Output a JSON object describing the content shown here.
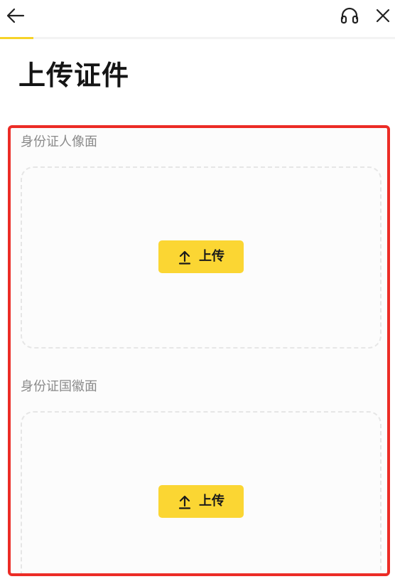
{
  "header": {
    "back_icon": "arrow-left-icon",
    "support_icon": "headset-icon",
    "close_icon": "close-icon",
    "progress_fraction": 0.085,
    "progress_color": "#f6d328"
  },
  "page": {
    "title": "上传证件"
  },
  "upload_sections": [
    {
      "label": "身份证人像面",
      "button_label": "上传",
      "button_icon": "upload-arrow-icon"
    },
    {
      "label": "身份证国徽面",
      "button_label": "上传",
      "button_icon": "upload-arrow-icon"
    }
  ],
  "colors": {
    "accent": "#fbd633",
    "highlight_border": "#ec2c26",
    "label_text": "#8a8a8a",
    "title_text": "#151515"
  }
}
